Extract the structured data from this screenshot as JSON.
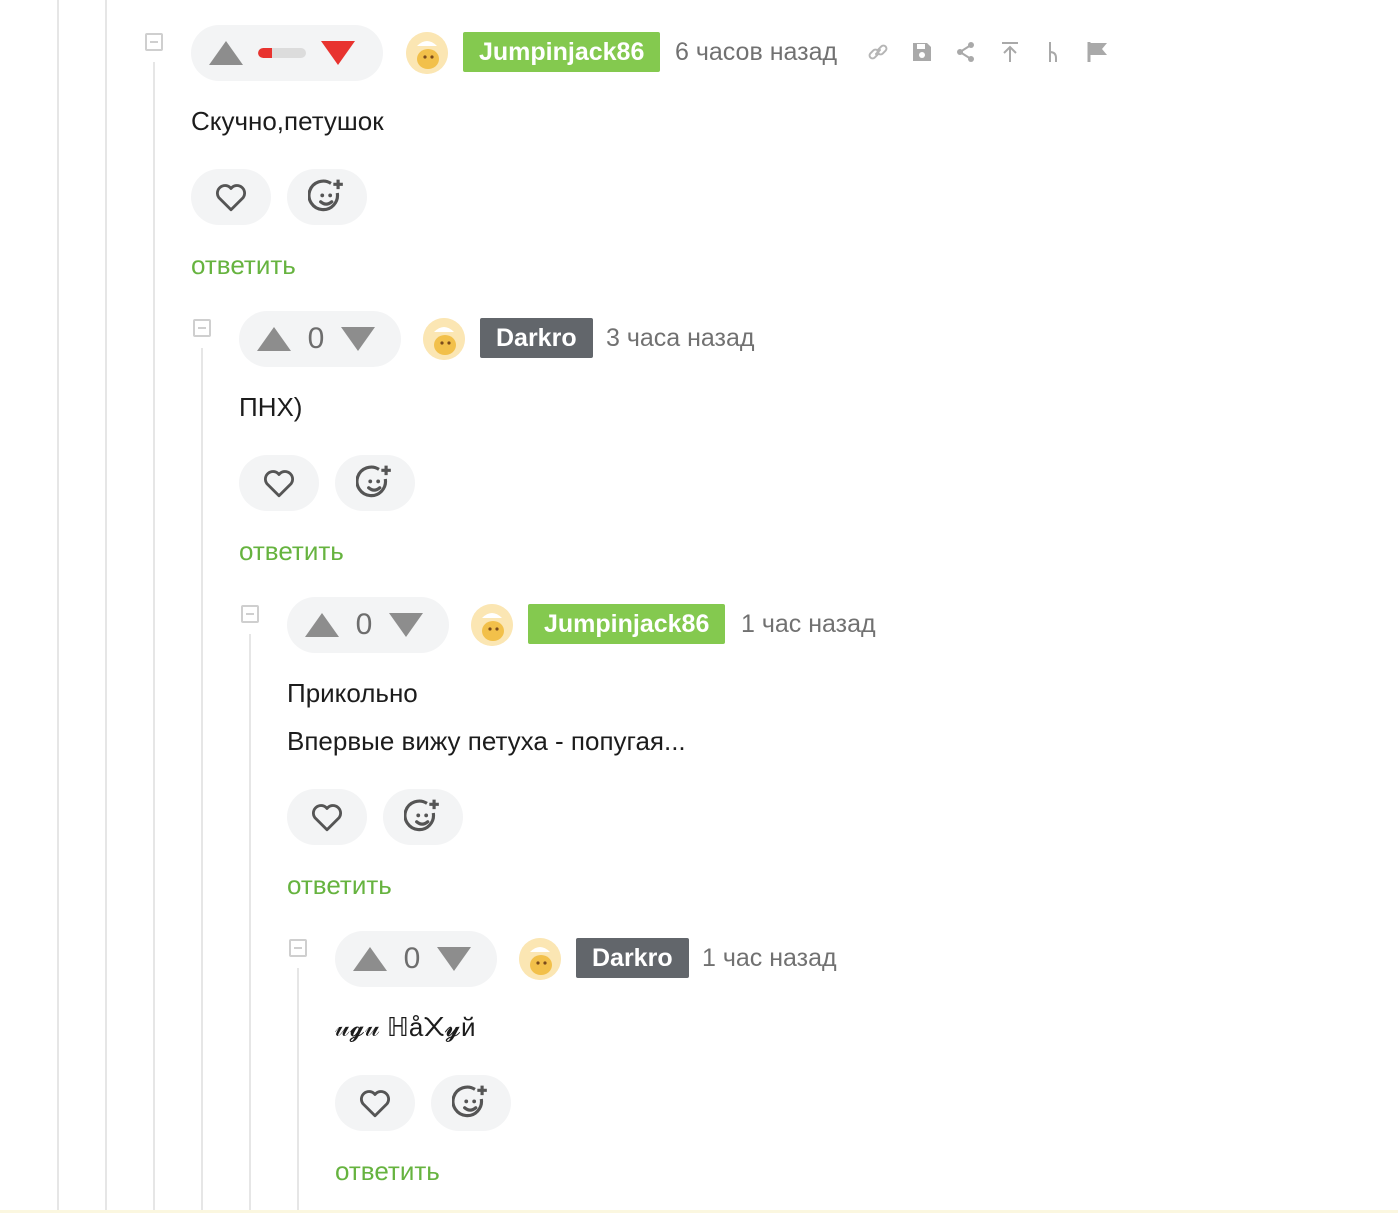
{
  "colors": {
    "accent_green": "#66b33f",
    "badge_green": "#84c94f",
    "badge_gray": "#62666b",
    "downvote_red": "#e8332f"
  },
  "comments": [
    {
      "author": "Jumpinjack86",
      "time": "6 часов назад",
      "lines": [
        "Скучно,петушок"
      ],
      "reply_label": "ответить",
      "score_display": "bar",
      "toolbar_icons": [
        "link-icon",
        "save-icon",
        "share-icon",
        "scroll-top-icon",
        "branch-icon",
        "flag-icon"
      ]
    },
    {
      "author": "Darkro",
      "time": "3 часа назад",
      "score": "0",
      "lines": [
        "ПНХ)"
      ],
      "reply_label": "ответить"
    },
    {
      "author": "Jumpinjack86",
      "time": "1 час назад",
      "score": "0",
      "lines": [
        "Прикольно",
        "Впервые вижу петуха - попугая..."
      ],
      "reply_label": "ответить"
    },
    {
      "author": "Darkro",
      "time": "1 час назад",
      "score": "0",
      "lines": [
        "𝓊𝓰𝓊 ℍå᙭𝔂й"
      ],
      "reply_label": "ответить"
    }
  ]
}
